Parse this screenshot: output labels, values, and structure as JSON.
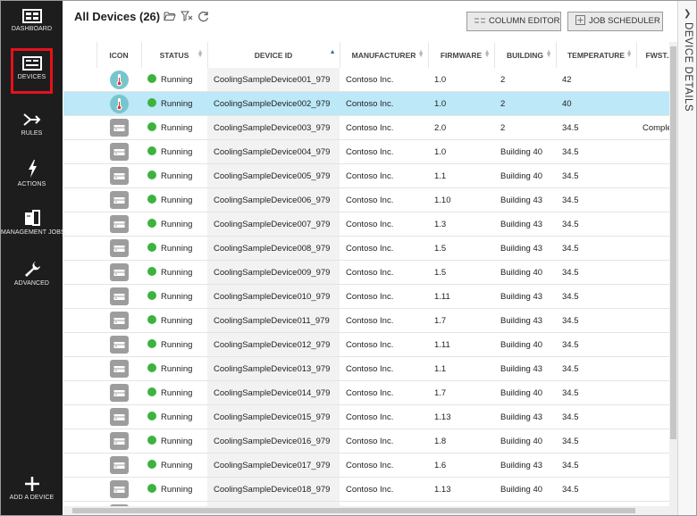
{
  "sidebar": {
    "items": [
      {
        "label": "DASHBOARD",
        "icon": "dashboard-icon"
      },
      {
        "label": "DEVICES",
        "icon": "devices-icon",
        "active": true
      },
      {
        "label": "RULES",
        "icon": "rules-icon"
      },
      {
        "label": "ACTIONS",
        "icon": "actions-icon"
      },
      {
        "label": "MANAGEMENT JOBS",
        "icon": "management-jobs-icon"
      },
      {
        "label": "ADVANCED",
        "icon": "advanced-icon"
      }
    ],
    "add_device": {
      "label": "ADD A DEVICE",
      "icon": "plus-icon"
    }
  },
  "header": {
    "title": "All Devices (26)",
    "column_editor_label": "COLUMN EDITOR",
    "job_scheduler_label": "JOB SCHEDULER"
  },
  "right_panel": {
    "label": "DEVICE DETAILS"
  },
  "table": {
    "columns": [
      "ICON",
      "STATUS",
      "DEVICE ID",
      "MANUFACTURER",
      "FIRMWARE",
      "BUILDING",
      "TEMPERATURE",
      "FWST..."
    ],
    "rows": [
      {
        "icon": "thermometer",
        "status": "Running",
        "device_id": "CoolingSampleDevice001_979",
        "manufacturer": "Contoso Inc.",
        "firmware": "1.0",
        "building": "2",
        "temperature": "42",
        "fwstatus": ""
      },
      {
        "icon": "thermometer",
        "status": "Running",
        "device_id": "CoolingSampleDevice002_979",
        "manufacturer": "Contoso Inc.",
        "firmware": "1.0",
        "building": "2",
        "temperature": "40",
        "fwstatus": "",
        "selected": true
      },
      {
        "icon": "device",
        "status": "Running",
        "device_id": "CoolingSampleDevice003_979",
        "manufacturer": "Contoso Inc.",
        "firmware": "2.0",
        "building": "2",
        "temperature": "34.5",
        "fwstatus": "Comple"
      },
      {
        "icon": "device",
        "status": "Running",
        "device_id": "CoolingSampleDevice004_979",
        "manufacturer": "Contoso Inc.",
        "firmware": "1.0",
        "building": "Building 40",
        "temperature": "34.5",
        "fwstatus": ""
      },
      {
        "icon": "device",
        "status": "Running",
        "device_id": "CoolingSampleDevice005_979",
        "manufacturer": "Contoso Inc.",
        "firmware": "1.1",
        "building": "Building 40",
        "temperature": "34.5",
        "fwstatus": ""
      },
      {
        "icon": "device",
        "status": "Running",
        "device_id": "CoolingSampleDevice006_979",
        "manufacturer": "Contoso Inc.",
        "firmware": "1.10",
        "building": "Building 43",
        "temperature": "34.5",
        "fwstatus": ""
      },
      {
        "icon": "device",
        "status": "Running",
        "device_id": "CoolingSampleDevice007_979",
        "manufacturer": "Contoso Inc.",
        "firmware": "1.3",
        "building": "Building 43",
        "temperature": "34.5",
        "fwstatus": ""
      },
      {
        "icon": "device",
        "status": "Running",
        "device_id": "CoolingSampleDevice008_979",
        "manufacturer": "Contoso Inc.",
        "firmware": "1.5",
        "building": "Building 43",
        "temperature": "34.5",
        "fwstatus": ""
      },
      {
        "icon": "device",
        "status": "Running",
        "device_id": "CoolingSampleDevice009_979",
        "manufacturer": "Contoso Inc.",
        "firmware": "1.5",
        "building": "Building 40",
        "temperature": "34.5",
        "fwstatus": ""
      },
      {
        "icon": "device",
        "status": "Running",
        "device_id": "CoolingSampleDevice010_979",
        "manufacturer": "Contoso Inc.",
        "firmware": "1.11",
        "building": "Building 43",
        "temperature": "34.5",
        "fwstatus": ""
      },
      {
        "icon": "device",
        "status": "Running",
        "device_id": "CoolingSampleDevice011_979",
        "manufacturer": "Contoso Inc.",
        "firmware": "1.7",
        "building": "Building 43",
        "temperature": "34.5",
        "fwstatus": ""
      },
      {
        "icon": "device",
        "status": "Running",
        "device_id": "CoolingSampleDevice012_979",
        "manufacturer": "Contoso Inc.",
        "firmware": "1.11",
        "building": "Building 40",
        "temperature": "34.5",
        "fwstatus": ""
      },
      {
        "icon": "device",
        "status": "Running",
        "device_id": "CoolingSampleDevice013_979",
        "manufacturer": "Contoso Inc.",
        "firmware": "1.1",
        "building": "Building 43",
        "temperature": "34.5",
        "fwstatus": ""
      },
      {
        "icon": "device",
        "status": "Running",
        "device_id": "CoolingSampleDevice014_979",
        "manufacturer": "Contoso Inc.",
        "firmware": "1.7",
        "building": "Building 40",
        "temperature": "34.5",
        "fwstatus": ""
      },
      {
        "icon": "device",
        "status": "Running",
        "device_id": "CoolingSampleDevice015_979",
        "manufacturer": "Contoso Inc.",
        "firmware": "1.13",
        "building": "Building 43",
        "temperature": "34.5",
        "fwstatus": ""
      },
      {
        "icon": "device",
        "status": "Running",
        "device_id": "CoolingSampleDevice016_979",
        "manufacturer": "Contoso Inc.",
        "firmware": "1.8",
        "building": "Building 40",
        "temperature": "34.5",
        "fwstatus": ""
      },
      {
        "icon": "device",
        "status": "Running",
        "device_id": "CoolingSampleDevice017_979",
        "manufacturer": "Contoso Inc.",
        "firmware": "1.6",
        "building": "Building 43",
        "temperature": "34.5",
        "fwstatus": ""
      },
      {
        "icon": "device",
        "status": "Running",
        "device_id": "CoolingSampleDevice018_979",
        "manufacturer": "Contoso Inc.",
        "firmware": "1.13",
        "building": "Building 40",
        "temperature": "34.5",
        "fwstatus": ""
      },
      {
        "icon": "device",
        "status": "",
        "device_id": "",
        "manufacturer": "",
        "firmware": "",
        "building": "",
        "temperature": "",
        "fwstatus": ""
      }
    ]
  },
  "colors": {
    "sidebar_bg": "#1d1d1d",
    "active_border": "#e6111a",
    "selected_row": "#bce8f8",
    "running_dot": "#3db33d",
    "thermometer_icon_bg": "#78c6cd",
    "device_icon_bg": "#9d9d9d"
  }
}
